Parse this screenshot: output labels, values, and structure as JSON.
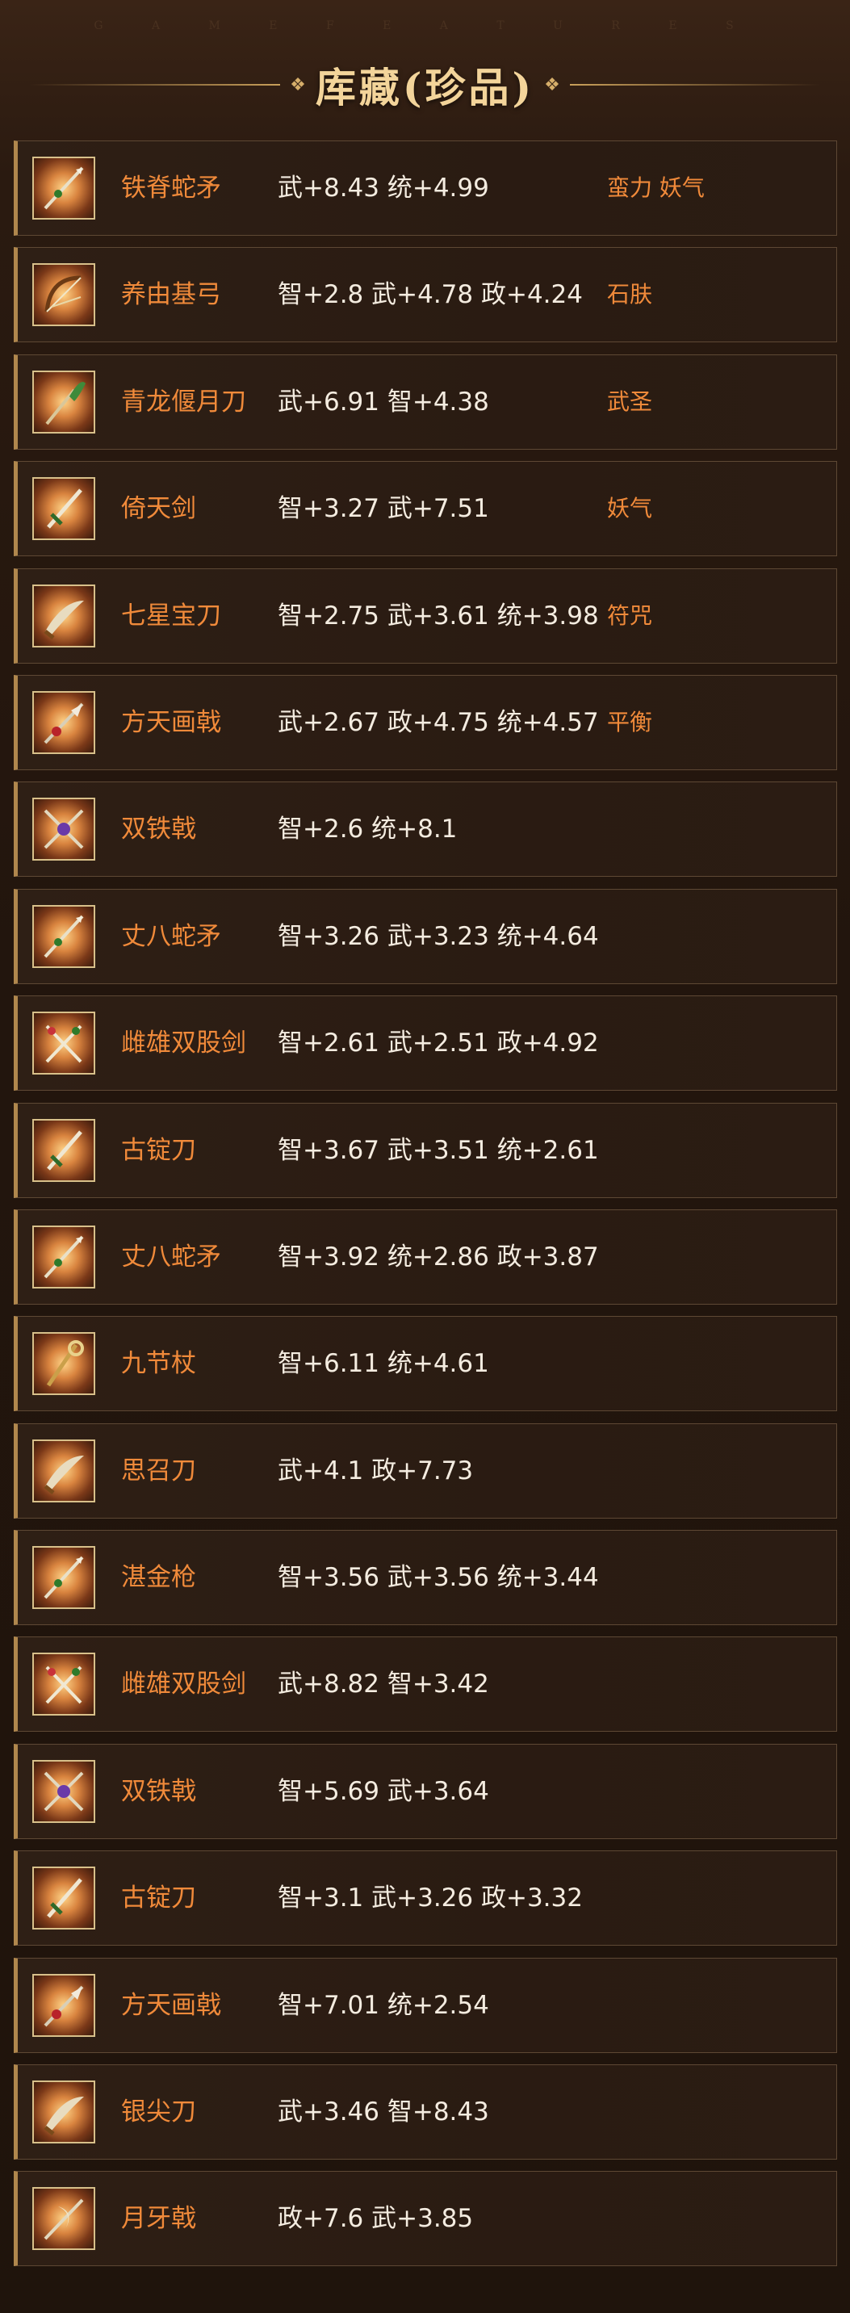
{
  "watermark": "G A M E   F E A T U R E S",
  "header": {
    "title": "库藏(珍品)"
  },
  "items": [
    {
      "name": "铁脊蛇矛",
      "stats": "武+8.43 统+4.99",
      "traits": "蛮力 妖气",
      "icon": "spear-icon"
    },
    {
      "name": "养由基弓",
      "stats": "智+2.8 武+4.78 政+4.24",
      "traits": "石肤",
      "icon": "bow-icon"
    },
    {
      "name": "青龙偃月刀",
      "stats": "武+6.91 智+4.38",
      "traits": "武圣",
      "icon": "glaive-icon"
    },
    {
      "name": "倚天剑",
      "stats": "智+3.27 武+7.51",
      "traits": "妖气",
      "icon": "sword-icon"
    },
    {
      "name": "七星宝刀",
      "stats": "智+2.75 武+3.61 统+3.98",
      "traits": "符咒",
      "icon": "blade-icon"
    },
    {
      "name": "方天画戟",
      "stats": "武+2.67 政+4.75 统+4.57",
      "traits": "平衡",
      "icon": "halberd-icon"
    },
    {
      "name": "双铁戟",
      "stats": "智+2.6 统+8.1",
      "traits": "",
      "icon": "twin-halberd-icon"
    },
    {
      "name": "丈八蛇矛",
      "stats": "智+3.26 武+3.23 统+4.64",
      "traits": "",
      "icon": "spear-icon"
    },
    {
      "name": "雌雄双股剑",
      "stats": "智+2.61 武+2.51 政+4.92",
      "traits": "",
      "icon": "twin-sword-icon"
    },
    {
      "name": "古锭刀",
      "stats": "智+3.67 武+3.51 统+2.61",
      "traits": "",
      "icon": "sword-icon"
    },
    {
      "name": "丈八蛇矛",
      "stats": "智+3.92 统+2.86 政+3.87",
      "traits": "",
      "icon": "spear-icon"
    },
    {
      "name": "九节杖",
      "stats": "智+6.11 统+4.61",
      "traits": "",
      "icon": "staff-icon"
    },
    {
      "name": "思召刀",
      "stats": "武+4.1 政+7.73",
      "traits": "",
      "icon": "blade-icon"
    },
    {
      "name": "湛金枪",
      "stats": "智+3.56 武+3.56 统+3.44",
      "traits": "",
      "icon": "spear-icon"
    },
    {
      "name": "雌雄双股剑",
      "stats": "武+8.82 智+3.42",
      "traits": "",
      "icon": "twin-sword-icon"
    },
    {
      "name": "双铁戟",
      "stats": "智+5.69 武+3.64",
      "traits": "",
      "icon": "twin-halberd-icon"
    },
    {
      "name": "古锭刀",
      "stats": "智+3.1 武+3.26 政+3.32",
      "traits": "",
      "icon": "sword-icon"
    },
    {
      "name": "方天画戟",
      "stats": "智+7.01 统+2.54",
      "traits": "",
      "icon": "halberd-icon"
    },
    {
      "name": "银尖刀",
      "stats": "武+3.46 智+8.43",
      "traits": "",
      "icon": "blade-icon"
    },
    {
      "name": "月牙戟",
      "stats": "政+7.6 武+3.85",
      "traits": "",
      "icon": "crescent-halberd-icon"
    }
  ]
}
